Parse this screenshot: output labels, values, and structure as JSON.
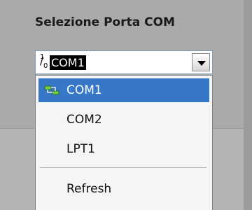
{
  "group": {
    "title": "Selezione Porta COM"
  },
  "combo": {
    "selected_value": "COM1"
  },
  "dropdown": {
    "items": [
      {
        "label": "COM1",
        "icon": "network-port-icon",
        "selected": true
      },
      {
        "label": "COM2"
      },
      {
        "label": "LPT1"
      },
      {
        "label": "Refresh"
      }
    ]
  },
  "colors": {
    "selection": "#3777c8",
    "panel": "#aaaaaa",
    "dropdown_bg": "#f5f5f5"
  }
}
